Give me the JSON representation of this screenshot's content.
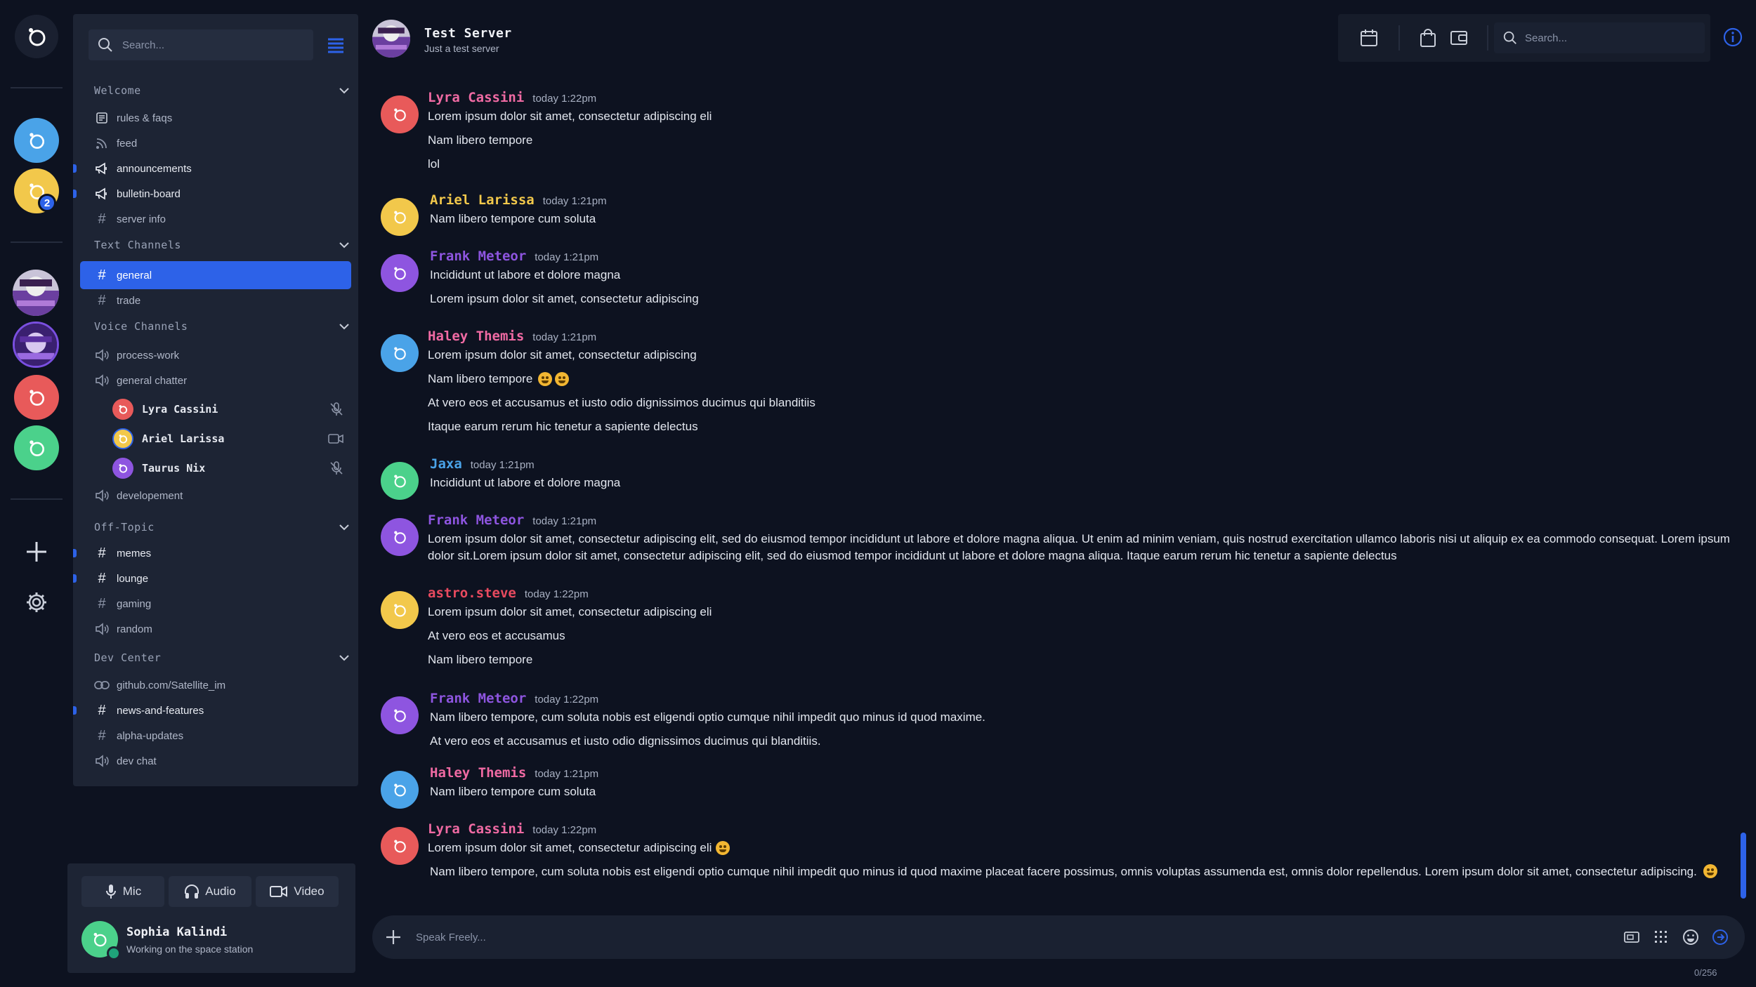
{
  "sidebar": {
    "search_placeholder": "Search...",
    "categories": {
      "welcome": "Welcome",
      "text": "Text Channels",
      "voice": "Voice Channels",
      "offtopic": "Off-Topic",
      "dev": "Dev Center"
    },
    "channels": {
      "rules": "rules & faqs",
      "feed": "feed",
      "announcements": "announcements",
      "bulletin": "bulletin-board",
      "serverinfo": "server info",
      "general": "general",
      "trade": "trade",
      "processwork": "process-work",
      "generalchatter": "general chatter",
      "developement": "developement",
      "memes": "memes",
      "lounge": "lounge",
      "gaming": "gaming",
      "random": "random",
      "github": "github.com/Satellite_im",
      "news": "news-and-features",
      "alpha": "alpha-updates",
      "devchat": "dev chat"
    },
    "voice_users": [
      "Lyra Cassini",
      "Ariel Larissa",
      "Taurus Nix"
    ]
  },
  "rail": {
    "badge_count": "2"
  },
  "user_panel": {
    "mic": "Mic",
    "audio": "Audio",
    "video": "Video",
    "name": "Sophia Kalindi",
    "status": "Working on the space station"
  },
  "header": {
    "title": "Test Server",
    "subtitle": "Just a test server",
    "search_placeholder": "Search..."
  },
  "messages": [
    {
      "author": "Lyra Cassini",
      "time": "today 1:22pm",
      "color": "#f06aa3",
      "avatar": "#e85a5a",
      "lines": [
        "Lorem ipsum dolor sit amet, consectetur adipiscing eli",
        "Nam libero tempore",
        "lol"
      ]
    },
    {
      "author": "Ariel Larissa",
      "time": "today 1:21pm",
      "color": "#f2c84b",
      "avatar": "#f2c84b",
      "lines": [
        "Nam libero tempore cum soluta"
      ]
    },
    {
      "author": "Frank Meteor",
      "time": "today 1:21pm",
      "color": "#8e55e0",
      "avatar": "#8e55e0",
      "lines": [
        "Incididunt ut labore et dolore magna",
        "Lorem ipsum dolor sit amet, consectetur adipiscing"
      ]
    },
    {
      "author": "Haley Themis",
      "time": "today 1:21pm",
      "color": "#f06aa3",
      "avatar": "#4aa3e8",
      "lines": [
        "Lorem ipsum dolor sit amet, consectetur adipiscing",
        "Nam libero tempore",
        "At vero eos et accusamus et iusto odio dignissimos ducimus qui blanditiis",
        "Itaque earum rerum hic tenetur a sapiente delectus"
      ]
    },
    {
      "author": "Jaxa",
      "time": "today 1:21pm",
      "color": "#4aa3e8",
      "avatar": "#4bd18b",
      "lines": [
        "Incididunt ut labore et dolore magna"
      ]
    },
    {
      "author": "Frank Meteor",
      "time": "today 1:21pm",
      "color": "#8e55e0",
      "avatar": "#8e55e0",
      "lines": [
        "Lorem ipsum dolor sit amet, consectetur adipiscing elit, sed do eiusmod tempor incididunt ut labore et dolore magna aliqua. Ut enim ad minim veniam, quis nostrud exercitation ullamco laboris nisi ut aliquip ex ea commodo consequat. Lorem ipsum dolor sit.Lorem ipsum dolor sit amet, consectetur adipiscing elit, sed do eiusmod tempor incididunt ut labore et dolore magna aliqua. Itaque earum rerum hic tenetur a sapiente delectus"
      ]
    },
    {
      "author": "astro.steve",
      "time": "today 1:22pm",
      "color": "#e84a5f",
      "avatar": "#f2c84b",
      "lines": [
        "Lorem ipsum dolor sit amet, consectetur adipiscing eli",
        "At vero eos et accusamus",
        "Nam libero tempore"
      ]
    },
    {
      "author": "Frank Meteor",
      "time": "today 1:22pm",
      "color": "#8e55e0",
      "avatar": "#8e55e0",
      "lines": [
        "Nam libero tempore, cum soluta nobis est eligendi optio cumque nihil impedit quo minus id quod maxime.",
        "At vero eos et accusamus et iusto odio dignissimos ducimus qui blanditiis."
      ]
    },
    {
      "author": "Haley Themis",
      "time": "today 1:21pm",
      "color": "#f06aa3",
      "avatar": "#4aa3e8",
      "lines": [
        "Nam libero tempore cum soluta"
      ]
    },
    {
      "author": "Lyra Cassini",
      "time": "today 1:22pm",
      "color": "#f06aa3",
      "avatar": "#e85a5a",
      "lines": [
        "Lorem ipsum dolor sit amet, consectetur adipiscing eli",
        "Nam libero tempore, cum soluta nobis est eligendi optio cumque nihil impedit quo minus id quod maxime placeat facere possimus, omnis voluptas assumenda est, omnis dolor repellendus. Lorem ipsum dolor sit amet, consectetur adipiscing."
      ]
    }
  ],
  "composer": {
    "placeholder": "Speak Freely...",
    "counter": "0/256"
  },
  "colors": {
    "accent": "#2d62e8",
    "background": "#0d1220",
    "panel": "#1d2434"
  },
  "icons": [
    "logo-icon",
    "search-icon",
    "menu-icon",
    "chevron-down-icon",
    "rules-icon",
    "feed-icon",
    "megaphone-icon",
    "hash-icon",
    "speaker-icon",
    "link-icon",
    "mic-off-icon",
    "camera-icon",
    "mic-icon",
    "headphones-icon",
    "video-icon",
    "plus-icon",
    "gear-icon",
    "calendar-icon",
    "shopping-bag-icon",
    "wallet-icon",
    "info-icon",
    "gif-icon",
    "grid-icon",
    "smile-icon",
    "send-icon"
  ]
}
